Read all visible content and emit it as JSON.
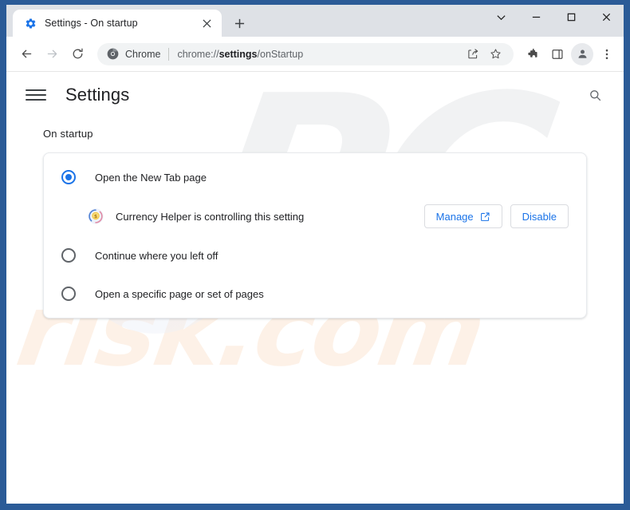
{
  "browser": {
    "tab": {
      "title": "Settings - On startup",
      "favicon": "gear-icon",
      "close_label": "✕"
    },
    "new_tab_label": "+",
    "window_controls": {
      "tab_search": "chevron-down-icon",
      "minimize": "minimize-icon",
      "maximize": "maximize-icon",
      "close": "close-icon"
    },
    "toolbar": {
      "back": "back-arrow-icon",
      "forward": "forward-arrow-icon",
      "reload": "reload-icon",
      "omnibox": {
        "chip_icon": "chrome-logo-icon",
        "chip_label": "Chrome",
        "url_prefix": "chrome://",
        "url_bold": "settings",
        "url_suffix": "/onStartup",
        "share_icon": "share-icon",
        "bookmark_icon": "star-icon"
      },
      "extensions_icon": "puzzle-piece-icon",
      "side_panel_icon": "side-panel-icon",
      "profile_icon": "person-avatar-icon",
      "menu_icon": "three-dot-menu-icon"
    }
  },
  "settings": {
    "menu_icon": "hamburger-menu-icon",
    "title": "Settings",
    "search_icon": "search-icon",
    "section_title": "On startup",
    "options": [
      {
        "label": "Open the New Tab page",
        "checked": true
      },
      {
        "label": "Continue where you left off",
        "checked": false
      },
      {
        "label": "Open a specific page or set of pages",
        "checked": false
      }
    ],
    "extension_notice": {
      "icon": "currency-helper-extension-icon",
      "text": "Currency Helper is controlling this setting",
      "manage_label": "Manage",
      "manage_icon": "external-link-icon",
      "disable_label": "Disable"
    }
  },
  "watermarks": {
    "primary": "PC",
    "secondary": "risk.com"
  },
  "colors": {
    "accent_blue": "#1a73e8",
    "window_frame": "#2b5b97",
    "tabstrip": "#dee1e6",
    "watermark_gray": "#f1f2f3",
    "watermark_peach": "#fdf1e7"
  }
}
